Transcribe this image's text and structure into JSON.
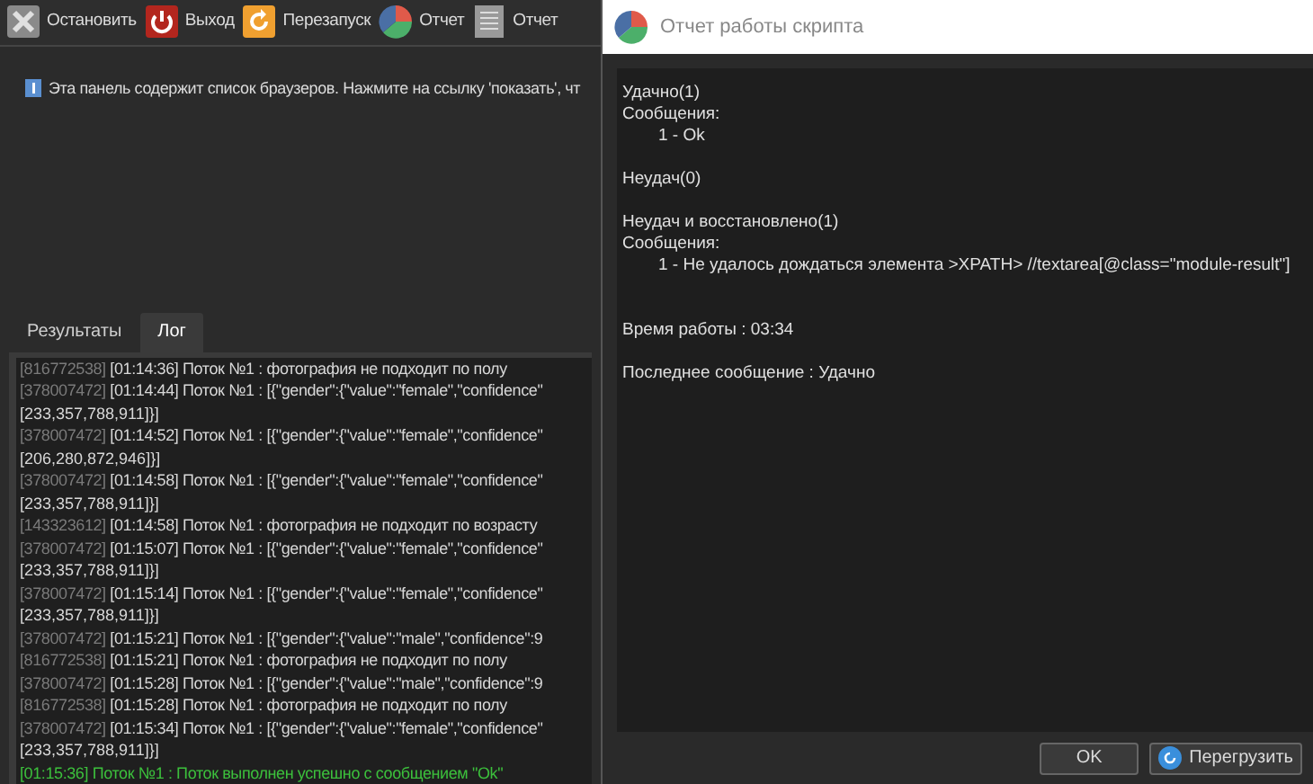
{
  "toolbar": {
    "buttons": [
      {
        "kind": "stop",
        "label": "Остановить"
      },
      {
        "kind": "exit",
        "label": "Выход"
      },
      {
        "kind": "restart",
        "label": "Перезапуск"
      },
      {
        "kind": "chart",
        "label": "Отчет"
      },
      {
        "kind": "document",
        "label": "Отчет"
      }
    ]
  },
  "info_text": "Эта панель содержит список браузеров. Нажмите на ссылку 'показать', чт",
  "tabs": [
    {
      "label": "Результаты",
      "selected": false
    },
    {
      "label": "Лог",
      "selected": true
    }
  ],
  "log": [
    {
      "kind": "info",
      "id": "[816772538]",
      "time": "[01:14:36]",
      "text": "Поток №1 : фотография не подходит по полу"
    },
    {
      "kind": "info",
      "id": "[378007472]",
      "time": "[01:14:44]",
      "text": "Поток №1 : [{\"gender\":{\"value\":\"female\",\"confidence\"",
      "more": "[233,357,788,911]}]"
    },
    {
      "kind": "info",
      "id": "[378007472]",
      "time": "[01:14:52]",
      "text": "Поток №1 : [{\"gender\":{\"value\":\"female\",\"confidence\"",
      "more": "[206,280,872,946]}]"
    },
    {
      "kind": "info",
      "id": "[378007472]",
      "time": "[01:14:58]",
      "text": "Поток №1 : [{\"gender\":{\"value\":\"female\",\"confidence\"",
      "more": "[233,357,788,911]}]"
    },
    {
      "kind": "info",
      "id": "[143323612]",
      "time": "[01:14:58]",
      "text": "Поток №1 : фотография не подходит по возрасту"
    },
    {
      "kind": "info",
      "id": "[378007472]",
      "time": "[01:15:07]",
      "text": "Поток №1 : [{\"gender\":{\"value\":\"female\",\"confidence\"",
      "more": "[233,357,788,911]}]"
    },
    {
      "kind": "info",
      "id": "[378007472]",
      "time": "[01:15:14]",
      "text": "Поток №1 : [{\"gender\":{\"value\":\"female\",\"confidence\"",
      "more": "[233,357,788,911]}]"
    },
    {
      "kind": "info",
      "id": "[378007472]",
      "time": "[01:15:21]",
      "text": "Поток №1 : [{\"gender\":{\"value\":\"male\",\"confidence\":9"
    },
    {
      "kind": "info",
      "id": "[816772538]",
      "time": "[01:15:21]",
      "text": "Поток №1 : фотография не подходит по полу"
    },
    {
      "kind": "info",
      "id": "[378007472]",
      "time": "[01:15:28]",
      "text": "Поток №1 : [{\"gender\":{\"value\":\"male\",\"confidence\":9"
    },
    {
      "kind": "info",
      "id": "[816772538]",
      "time": "[01:15:28]",
      "text": "Поток №1 : фотография не подходит по полу"
    },
    {
      "kind": "info",
      "id": "[378007472]",
      "time": "[01:15:34]",
      "text": "Поток №1 : [{\"gender\":{\"value\":\"female\",\"confidence\"",
      "more": "[233,357,788,911]}]"
    },
    {
      "kind": "success",
      "time": "[01:15:36]",
      "text": "Поток №1 : Поток выполнен успешно с сообщением \"Ok\""
    }
  ],
  "dialog": {
    "title": "Отчет работы скрипта",
    "sections": [
      {
        "title": "Удачно(1)",
        "messages_label": "Сообщения:",
        "messages": [
          "1 - Ok"
        ]
      },
      {
        "title": "Неудач(0)"
      },
      {
        "title": "Неудач и восстановлено(1)",
        "messages_label": "Сообщения:",
        "messages": [
          "1 - Не удалось дождаться элемента  >XPATH> //textarea[@class=\"module-result\"]"
        ]
      }
    ],
    "run_time": "Время работы : 03:34",
    "last_message": "Последнее сообщение : Удачно",
    "buttons": [
      {
        "kind": "ok",
        "label": "OK"
      },
      {
        "kind": "reload",
        "label": "Перегрузить"
      }
    ]
  }
}
